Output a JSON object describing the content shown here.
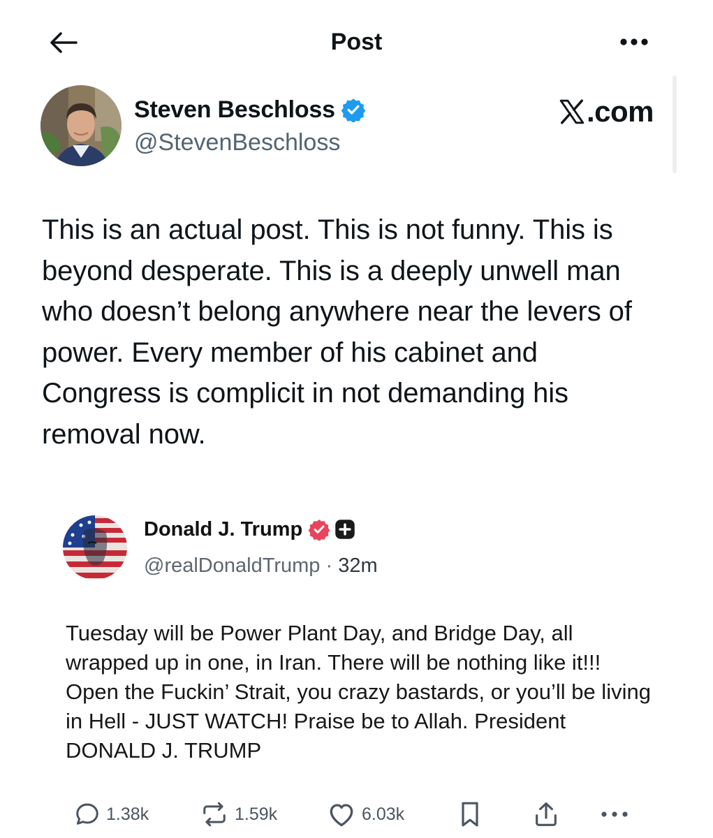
{
  "header": {
    "title": "Post",
    "back_icon": "arrow-left-icon",
    "more_icon": "more-horizontal-icon"
  },
  "author": {
    "name": "Steven Beschloss",
    "handle": "@StevenBeschloss",
    "verified_color": "#1d9bf0"
  },
  "brand": {
    "text": ".com"
  },
  "post": {
    "text": "This is an actual post. This is not funny. This is beyond desperate. This is a deeply unwell man who doesn’t belong anywhere near the levers of power. Every member of his cabinet and Congress is complicit in not demanding his removal now."
  },
  "quoted_post": {
    "name": "Donald J. Trump",
    "handle": "@realDonaldTrump",
    "separator": " · ",
    "time": "32m",
    "verified_color": "#e8455c",
    "text": "Tuesday will be Power Plant Day, and Bridge Day, all wrapped up in one, in Iran. There will be nothing like it!!! Open the Fuckin’ Strait, you crazy bastards, or you’ll be living in Hell - JUST WATCH! Praise be to Allah. President DONALD J. TRUMP",
    "actions": {
      "replies": "1.38k",
      "reposts": "1.59k",
      "likes": "6.03k"
    }
  }
}
